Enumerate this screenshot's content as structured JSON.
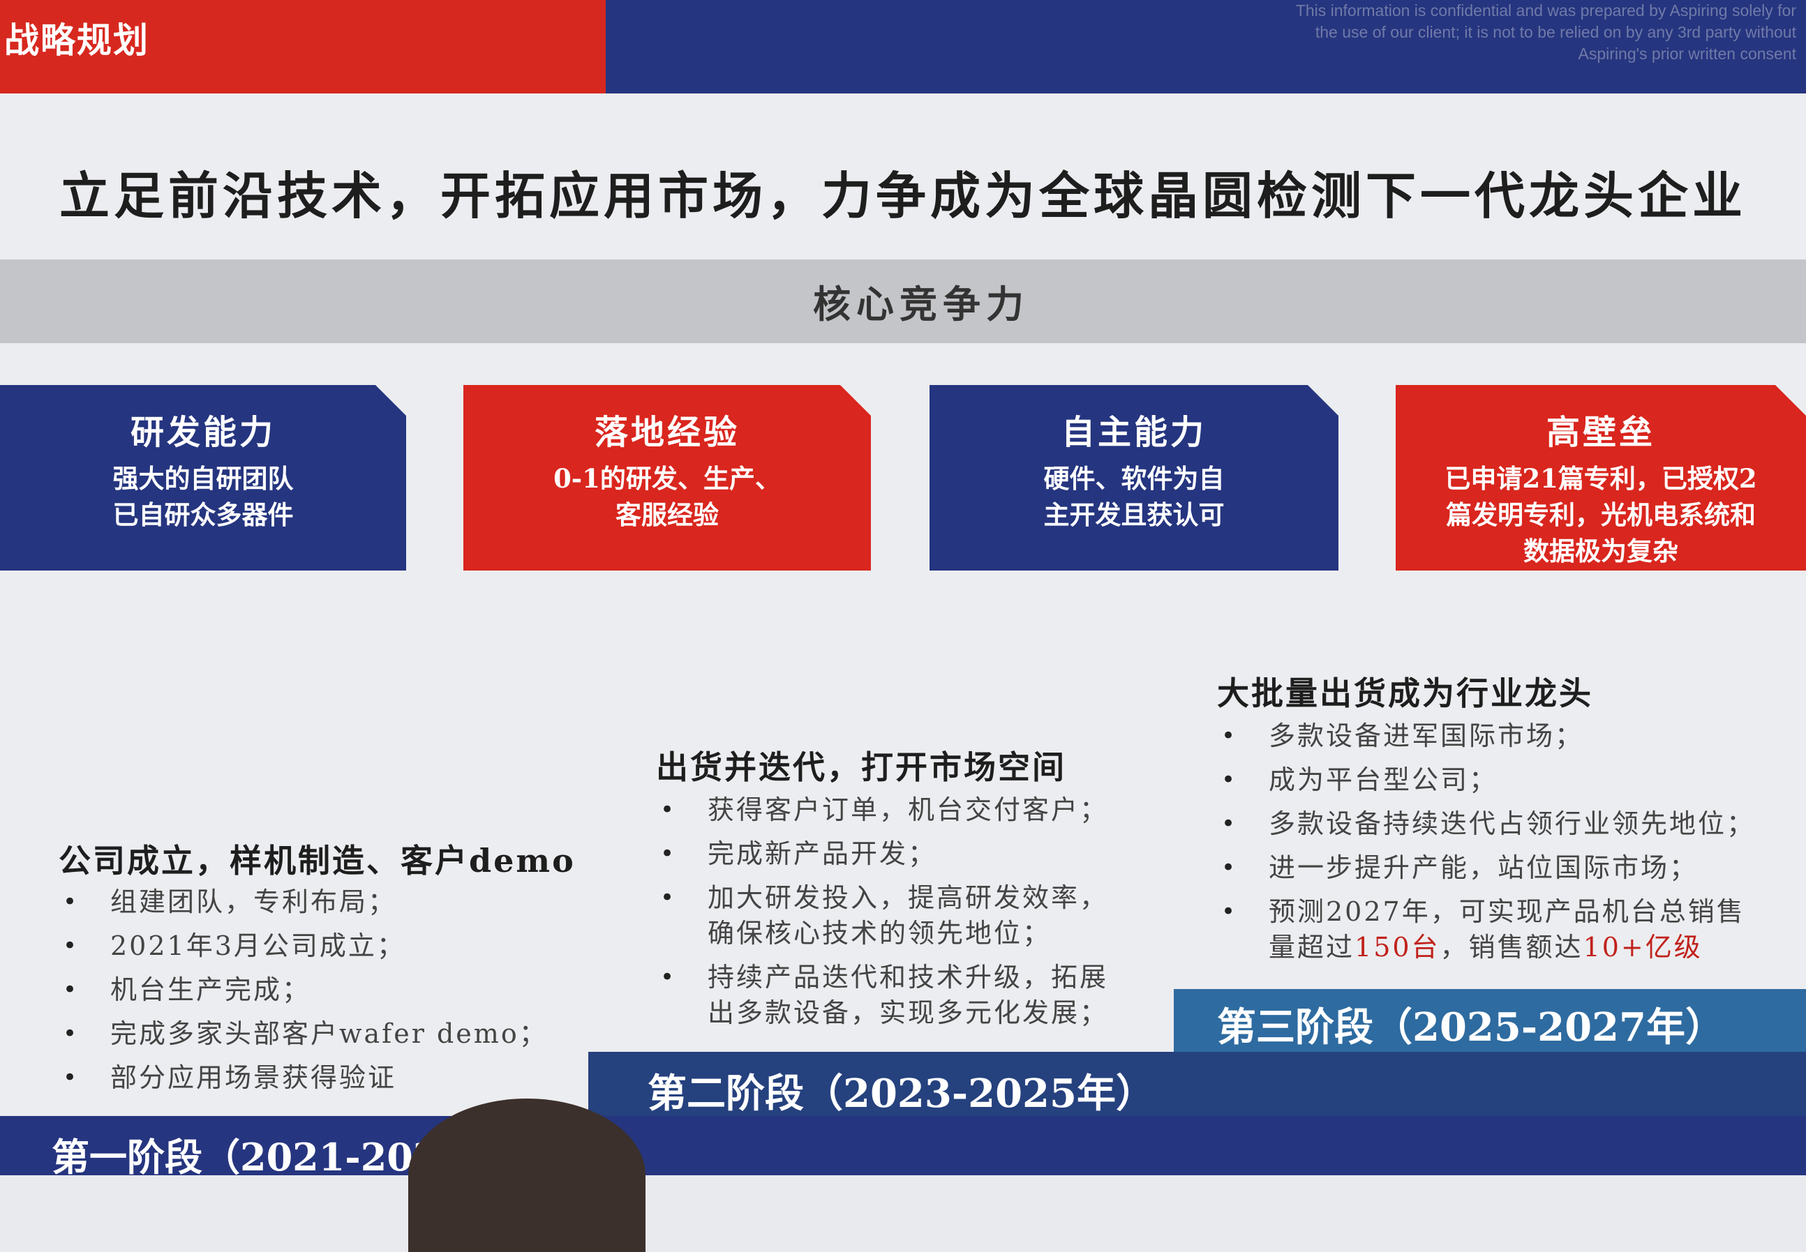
{
  "header": {
    "title": "战略规划",
    "disclaimer_lines": [
      "This information is confidential and was prepared by Aspiring solely for",
      "the use of our client; it is not to be relied on by any 3rd party without",
      "Aspiring's prior written consent"
    ]
  },
  "main_title": "立足前沿技术，开拓应用市场，力争成为全球晶圆检测下一代龙头企业",
  "core_label": "核心竞争力",
  "capabilities": [
    {
      "title": "研发能力",
      "lines": [
        "强大的自研团队",
        "已自研众多器件"
      ]
    },
    {
      "title": "落地经验",
      "lines": [
        "0-1的研发、生产、",
        "客服经验"
      ]
    },
    {
      "title": "自主能力",
      "lines": [
        "硬件、软件为自",
        "主开发且获认可"
      ]
    },
    {
      "title": "高壁垒",
      "lines": [
        "已申请21篇专利，已授权2",
        "篇发明专利，光机电系统和",
        "数据极为复杂"
      ]
    }
  ],
  "stages": [
    {
      "band_label": "第一阶段（2021-202",
      "heading": "公司成立，样机制造、客户demo",
      "bullets": [
        "组建团队，专利布局；",
        "2021年3月公司成立；",
        "机台生产完成；",
        "完成多家头部客户wafer demo；",
        "部分应用场景获得验证"
      ]
    },
    {
      "band_label": "第二阶段（2023-2025年）",
      "heading": "出货并迭代，打开市场空间",
      "bullets": [
        "获得客户订单，机台交付客户；",
        "完成新产品开发；",
        "加大研发投入，提高研发效率，",
        "确保核心技术的领先地位；",
        "持续产品迭代和技术升级，拓展",
        "出多款设备，实现多元化发展；"
      ]
    },
    {
      "band_label": "第三阶段（2025-2027年）",
      "heading": "大批量出货成为行业龙头",
      "bullets": [
        "多款设备进军国际市场；",
        "成为平台型公司；",
        "多款设备持续迭代占领行业领先地位；",
        "进一步提升产能，站位国际市场；"
      ],
      "forecast": {
        "pre": "预测2027年，可实现产品机台总销售",
        "line2_pre": "量超过",
        "units": "150台",
        "mid": "，销售额达",
        "revenue": "10+亿级"
      }
    }
  ],
  "bullet_symbol": "•",
  "colors": {
    "red": "#d9261e",
    "blue": "#25357f",
    "band3": "#2e6ba0",
    "highlight": "#c0221b"
  }
}
